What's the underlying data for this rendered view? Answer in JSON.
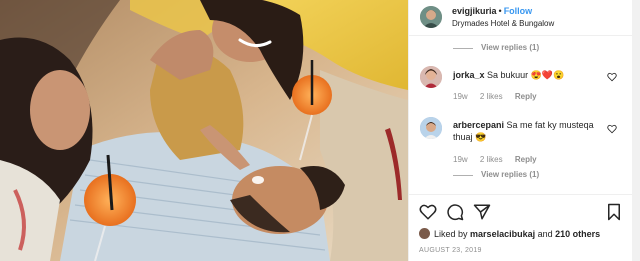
{
  "post": {
    "username": "evigjikuria",
    "follow_label": "Follow",
    "location": "Drymades Hotel & Bungalow"
  },
  "comments": {
    "view_replies_top": "View replies (1)",
    "items": [
      {
        "username": "jorka_x",
        "text": "Sa bukuur 😍❤️😮",
        "age": "19w",
        "likes": "2 likes",
        "reply_label": "Reply"
      },
      {
        "username": "arbercepani",
        "text": "Sa me fat ky musteqa thuaj 😎",
        "age": "19w",
        "likes": "2 likes",
        "reply_label": "Reply",
        "view_replies": "View replies (1)"
      }
    ]
  },
  "actions": {
    "icons": [
      "heart-icon",
      "comment-icon",
      "share-icon",
      "bookmark-icon"
    ],
    "liked_by_prefix": "Liked by",
    "liked_by_user": "marselacibukaj",
    "liked_by_suffix": "and",
    "others": "210 others",
    "date": "AUGUST 23, 2019"
  },
  "colors": {
    "follow": "#3897f0",
    "muted": "#8e8e8e",
    "text": "#262626"
  }
}
